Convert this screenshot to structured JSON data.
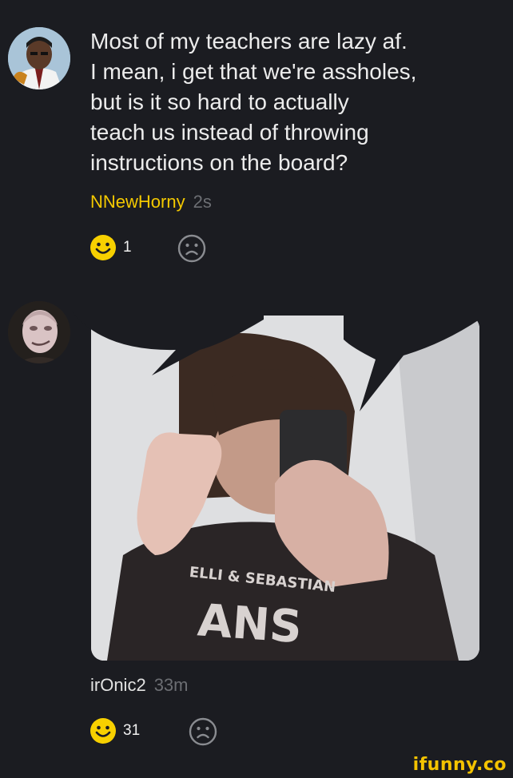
{
  "comment1": {
    "lines": [
      "Most of my teachers are lazy af.",
      "I mean, i get that we're assholes,",
      "but is it so hard to actually",
      "teach us instead of throwing",
      "instructions on the board?"
    ],
    "username": "NNewHorny",
    "time": "2s",
    "smile_count": "1"
  },
  "comment2": {
    "image_text": [
      "ELLI  &  SEBASTIAN",
      "ANS"
    ],
    "username": "irOnic2",
    "time": "33m",
    "smile_count": "31"
  },
  "colors": {
    "background": "#1b1c21",
    "accent": "#f4c900",
    "meta_gray": "#6c6e73"
  },
  "icons": [
    "avatar-1",
    "avatar-2",
    "smile-icon",
    "frown-icon",
    "ifunny-logo"
  ],
  "watermark": "ifunny.co"
}
